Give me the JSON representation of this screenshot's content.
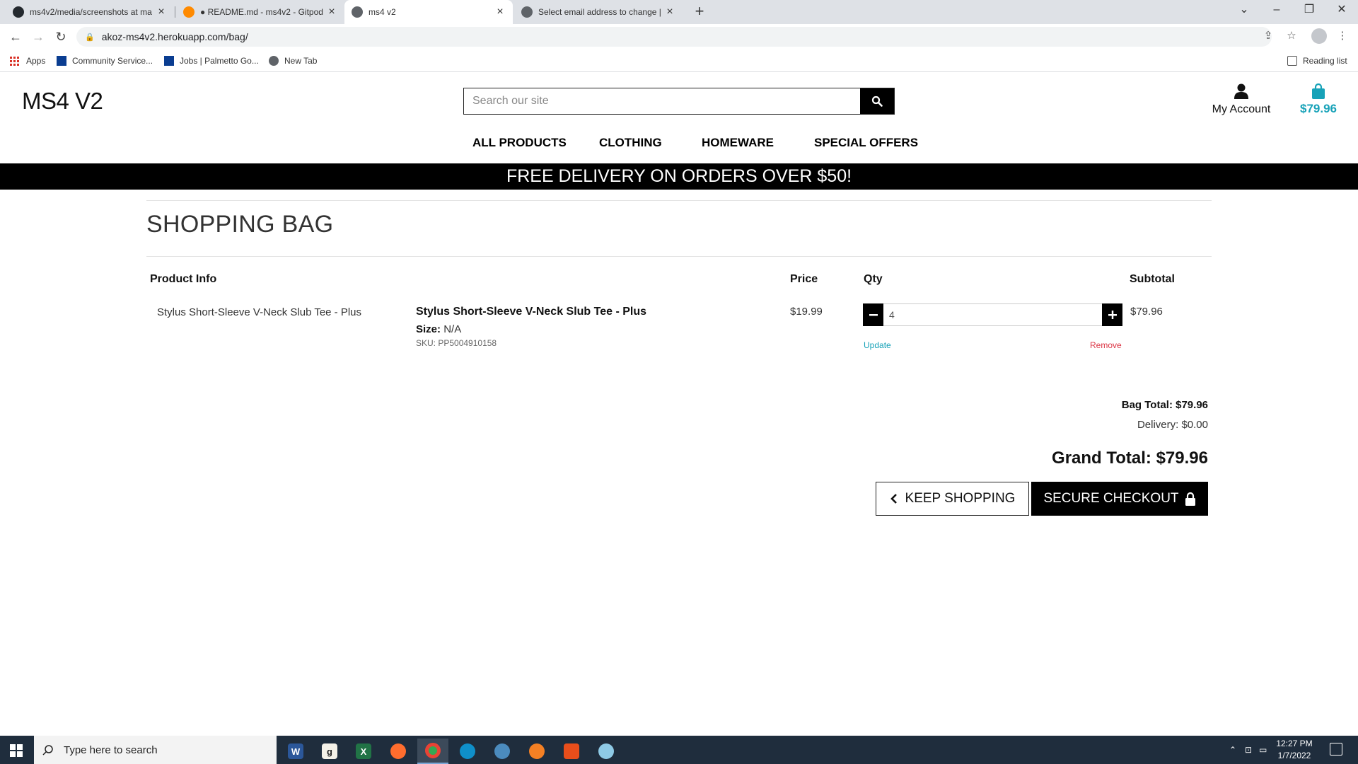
{
  "browser": {
    "tabs": [
      {
        "label": "ms4v2/media/screenshots at ma",
        "active": false
      },
      {
        "label": "● README.md - ms4v2 - Gitpod",
        "active": false
      },
      {
        "label": "ms4 v2",
        "active": true
      },
      {
        "label": "Select email address to change |",
        "active": false
      }
    ],
    "url": "akoz-ms4v2.herokuapp.com/bag/",
    "bookmarks": [
      {
        "label": "Apps"
      },
      {
        "label": "Community Service..."
      },
      {
        "label": "Jobs | Palmetto Go..."
      },
      {
        "label": "New Tab"
      }
    ],
    "reading_list": "Reading list"
  },
  "site": {
    "brand": "MS4 V2",
    "search_placeholder": "Search our site",
    "account_label": "My Account",
    "bag_total": "$79.96",
    "nav": [
      "ALL PRODUCTS",
      "CLOTHING",
      "HOMEWARE",
      "SPECIAL OFFERS"
    ],
    "banner": "FREE DELIVERY ON ORDERS OVER $50!",
    "accent": "#17a2b8"
  },
  "bag": {
    "title": "SHOPPING BAG",
    "headers": {
      "product": "Product Info",
      "price": "Price",
      "qty": "Qty",
      "subtotal": "Subtotal"
    },
    "item": {
      "image_alt": "Stylus Short-Sleeve V-Neck Slub Tee - Plus",
      "name": "Stylus Short-Sleeve V-Neck Slub Tee - Plus",
      "size_label": "Size:",
      "size_value": "N/A",
      "sku": "SKU: PP5004910158",
      "price": "$19.99",
      "qty": "4",
      "subtotal": "$79.96",
      "update": "Update",
      "remove": "Remove"
    },
    "bag_total": "Bag Total: $79.96",
    "delivery": "Delivery: $0.00",
    "grand_total": "Grand Total: $79.96",
    "keep_shopping": "KEEP SHOPPING",
    "checkout": "SECURE CHECKOUT"
  },
  "taskbar": {
    "search_placeholder": "Type here to search",
    "time": "12:27 PM",
    "date": "1/7/2022"
  }
}
